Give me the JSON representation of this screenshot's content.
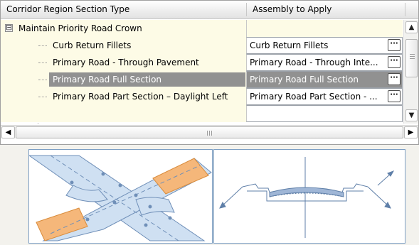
{
  "columns": {
    "region_type": "Corridor Region Section Type",
    "assembly": "Assembly to Apply"
  },
  "group": {
    "label": "Maintain Priority Road Crown",
    "expander": "⊟"
  },
  "rows": [
    {
      "label": "Curb Return Fillets",
      "assembly": "Curb Return Fillets",
      "button": "···"
    },
    {
      "label": "Primary Road - Through Pavement",
      "assembly": "Primary Road - Through Inte...",
      "button": "···"
    },
    {
      "label": "Primary Road Full Section",
      "assembly": "Primary Road Full Section",
      "button": "···",
      "selected": true
    },
    {
      "label": "Primary Road Part Section – Daylight Left",
      "assembly": "Primary Road Part Section - ...",
      "button": "···"
    }
  ],
  "scrollbars": {
    "up": "▲",
    "down": "▼",
    "left": "◀",
    "right": "▶"
  },
  "colors": {
    "row_background": "#fdfbe6",
    "selected_background": "#919191",
    "pavement_fill": "#cfe0f2",
    "daylight_fill": "#f5b77a",
    "outline": "#6f8fb8"
  },
  "icons": {
    "intersection_preview": "intersection-plan-icon",
    "section_preview": "cross-section-icon"
  }
}
